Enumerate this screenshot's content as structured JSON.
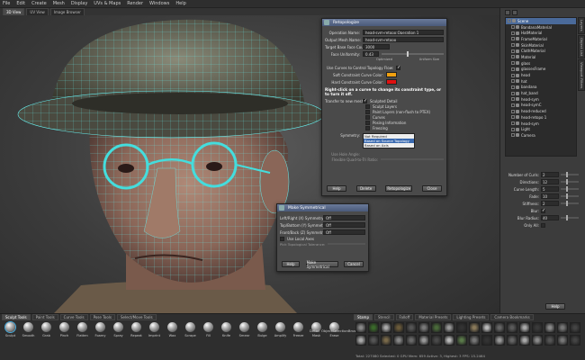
{
  "menubar": [
    "File",
    "Edit",
    "Create",
    "Mesh",
    "Display",
    "UVs & Maps",
    "Render",
    "Windows",
    "Help"
  ],
  "view_tabs": [
    "3D View",
    "UV View",
    "Image Browser"
  ],
  "retopo": {
    "title": "Retopologize",
    "operation_label": "Operation Name:",
    "operation_value": "head-sym-retopo:Operation 1",
    "output_label": "Output Mesh Name:",
    "output_value": "head-sym-retopo",
    "target_label": "Target Base Face Count:",
    "target_value": "3000",
    "face_label": "Face Uniformity:",
    "face_value": "0.43",
    "slider_left": "Optimized",
    "slider_right": "Uniform Size",
    "curves_label": "Use Curves to Control Topology Flow:",
    "soft_label": "Soft Constraint Curve Color:",
    "soft_color": "#f0a010",
    "hard_label": "Hard Constraint Curve Color:",
    "hard_color": "#e01010",
    "note": "Right-click on a curve to change its constraint type, or to turn it off.",
    "transfer_label": "Transfer to new mesh:",
    "transfer_options": [
      "Sculpted Detail",
      "Sculpt Layers",
      "Paint Layers (non-flush to PTEX)",
      "Curves",
      "Posing Information",
      "Freezing"
    ],
    "transfer_checked": [
      true,
      false,
      false,
      false,
      false,
      false
    ],
    "symmetry_label": "Symmetry:",
    "symmetry_options": [
      "Not Required",
      "Based on Source Topology",
      "Based on Axis"
    ],
    "symmetry_selected": 1,
    "use_hole_label": "Use Hole Angle:",
    "flexible_label": "Flexible Quad-to-Tri Ratio:",
    "buttons": [
      "Help",
      "Delete",
      "Retopologize",
      "Close"
    ]
  },
  "symmetric": {
    "title": "Make Symmetrical",
    "rows": [
      {
        "label": "Left/Right (X) Symmetry:",
        "value": "Off"
      },
      {
        "label": "Top/Bottom (Y) Symmetry:",
        "value": "Off"
      },
      {
        "label": "Front/Back (Z) Symmetry:",
        "value": "Off"
      }
    ],
    "use_local": "Use Local Axes",
    "topo_tolerance": "Pick Topological Tolerance:",
    "buttons": [
      "Help",
      "Make Symmetrical",
      "Cancel"
    ]
  },
  "outliner": {
    "items": [
      {
        "name": "Scene",
        "selected": true
      },
      {
        "name": "BandanaMaterial"
      },
      {
        "name": "HatMaterial"
      },
      {
        "name": "FrameMaterial"
      },
      {
        "name": "SkinMaterial"
      },
      {
        "name": "ClothMaterial"
      },
      {
        "name": "Material"
      },
      {
        "name": "glass"
      },
      {
        "name": "glassesFrame"
      },
      {
        "name": "head"
      },
      {
        "name": "hat"
      },
      {
        "name": "bandana"
      },
      {
        "name": "hat_band"
      },
      {
        "name": "head-sym"
      },
      {
        "name": "head-symC"
      },
      {
        "name": "head-reduced"
      },
      {
        "name": "head-retopo 1"
      },
      {
        "name": "head-sym"
      },
      {
        "name": "Light"
      },
      {
        "name": "Camera"
      }
    ],
    "side_tabs": [
      "Layers",
      "Object List",
      "Viewport Filters"
    ]
  },
  "properties": [
    {
      "label": "Number of Curls:",
      "value": "2"
    },
    {
      "label": "Directions:",
      "value": "12"
    },
    {
      "label": "Curve Length:",
      "value": "5"
    },
    {
      "label": "Fade:",
      "value": "10"
    },
    {
      "label": "Stiffness:",
      "value": "2"
    },
    {
      "label": "Blur:",
      "value": ""
    },
    {
      "label": "Blur Radius:",
      "value": "40"
    },
    {
      "label": "Only All:",
      "value": ""
    }
  ],
  "help_button": "Help",
  "tool_tabs": [
    "Sculpt Tools",
    "Paint Tools",
    "Curve Tools",
    "Pose Tools",
    "Select/Move Tools"
  ],
  "tools": [
    "Sculpt",
    "Smooth",
    "Grab",
    "Pinch",
    "Flatten",
    "Foamy",
    "Spray",
    "Repeat",
    "Imprint",
    "Wax",
    "Scrape",
    "Fill",
    "Knife",
    "Smear",
    "Bulge",
    "Amplify",
    "Freeze",
    "Mask",
    "Erase"
  ],
  "extra_tools": [
    "Detail",
    "ObjectSelectionBrush"
  ],
  "lib_tabs": [
    "Stamp",
    "Stencil",
    "Falloff",
    "Material Presets",
    "Lighting Presets",
    "Camera Bookmarks"
  ],
  "status": "Total: 227080  Selected: 0  GPU Mem: 659  Active: 3, Highest: 3  FPS: 15.2464",
  "swatch_colors": [
    "#8a8a8a",
    "#3a6a2a",
    "#aaa",
    "#6a5a3a",
    "#555",
    "#7a7a7a",
    "#4a6a3a",
    "#999",
    "#333",
    "#8a7a5a",
    "#bbb",
    "#666",
    "#5a5a5a",
    "#aaa",
    "#3a3a3a",
    "#8a8a8a",
    "#777",
    "#444",
    "#aaa",
    "#555",
    "#7a6a4a",
    "#888",
    "#6a6a6a",
    "#999",
    "#4a4a4a",
    "#bbb",
    "#5a7a4a",
    "#777",
    "#333",
    "#9a9a9a",
    "#666",
    "#aaa",
    "#8a8a8a",
    "#555",
    "#777",
    "#444"
  ]
}
